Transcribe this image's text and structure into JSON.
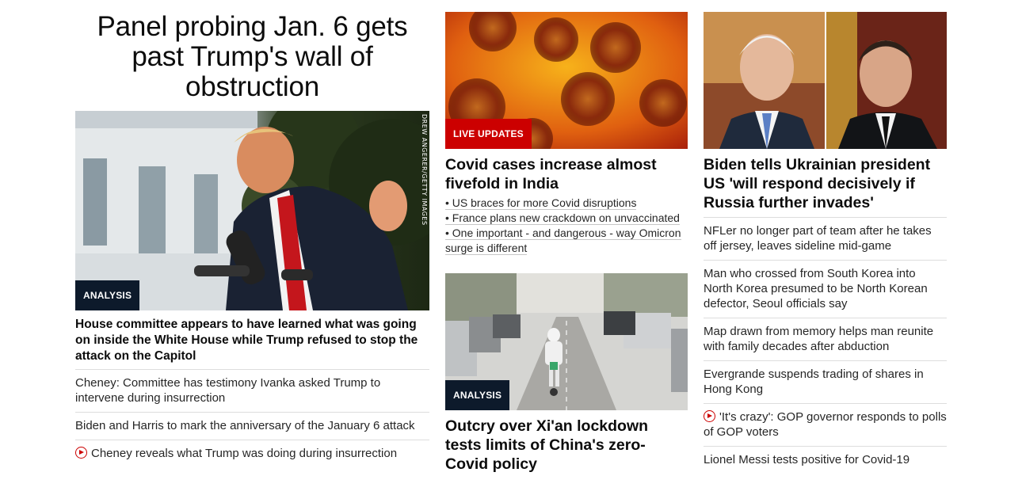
{
  "col1": {
    "headline": "Panel probing Jan. 6 gets past Trump's wall of obstruction",
    "badge": "ANALYSIS",
    "photo_credit": "DREW ANGERER/GETTY IMAGES",
    "lead_story": "House committee appears to have learned what was going on inside the White House while Trump refused to stop the attack on the Capitol",
    "links": [
      "Cheney: Committee has testimony Ivanka asked Trump to intervene during insurrection",
      "Biden and Harris to mark the anniversary of the January 6 attack",
      "Cheney reveals what Trump was doing during insurrection"
    ]
  },
  "col2": {
    "story1": {
      "badge": "LIVE UPDATES",
      "headline": "Covid cases increase almost fivefold in India",
      "bullets": [
        "US braces for more Covid disruptions",
        "France plans new crackdown on unvaccinated",
        "One important - and dangerous - way Omicron surge is different"
      ]
    },
    "story2": {
      "badge": "ANALYSIS",
      "headline": "Outcry over Xi'an lockdown tests limits of China's zero-Covid policy"
    }
  },
  "col3": {
    "headline": "Biden tells Ukrainian president US 'will respond decisively if Russia further invades'",
    "links": [
      "NFLer no longer part of team after he takes off jersey, leaves sideline mid-game",
      "Man who crossed from South Korea into North Korea presumed to be North Korean defector, Seoul officials say",
      "Map drawn from memory helps man reunite with family decades after abduction",
      "Evergrande suspends trading of shares in Hong Kong",
      "'It's crazy': GOP governor responds to polls of GOP voters",
      "Lionel Messi tests positive for Covid-19"
    ]
  },
  "icons": {
    "video": "play-circle-icon"
  },
  "colors": {
    "accent_red": "#cc0000",
    "badge_dark": "#0d1a2b",
    "text": "#262626"
  }
}
